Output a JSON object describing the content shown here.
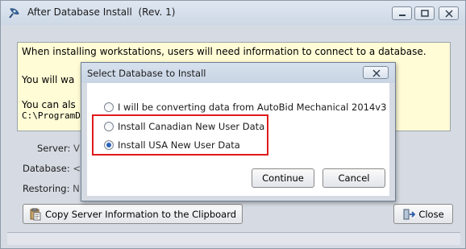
{
  "window": {
    "title": "After Database Install",
    "revision": "(Rev. 1)",
    "app_icon": "satellite-dish-icon",
    "controls": [
      "minimize-icon",
      "maximize-icon",
      "close-icon"
    ]
  },
  "info_panel": {
    "line1": "When installing workstations, users will need information to connect to a database.",
    "line2_fragment": "You will wa",
    "line3_fragment": "You can als",
    "line4_fragment": "C:\\ProgramD"
  },
  "fields": {
    "server_label": "Server:",
    "server_value_fragment": "V",
    "database_label": "Database:",
    "database_value_fragment": "<",
    "restoring_label": "Restoring:",
    "restoring_value_fragment": "N"
  },
  "buttons": {
    "copy_label": "Copy Server Information to the Clipboard",
    "copy_icon": "clipboard-icon",
    "close_label": "Close",
    "close_icon": "exit-door-icon"
  },
  "dialog": {
    "title": "Select Database to Install",
    "options": [
      {
        "label": "I will be converting data from AutoBid Mechanical 2014v3",
        "checked": false
      },
      {
        "label": "Install Canadian New User Data",
        "checked": false
      },
      {
        "label": "Install USA New User Data",
        "checked": true
      }
    ],
    "continue_label": "Continue",
    "cancel_label": "Cancel",
    "highlight_color": "#e01b1b"
  }
}
